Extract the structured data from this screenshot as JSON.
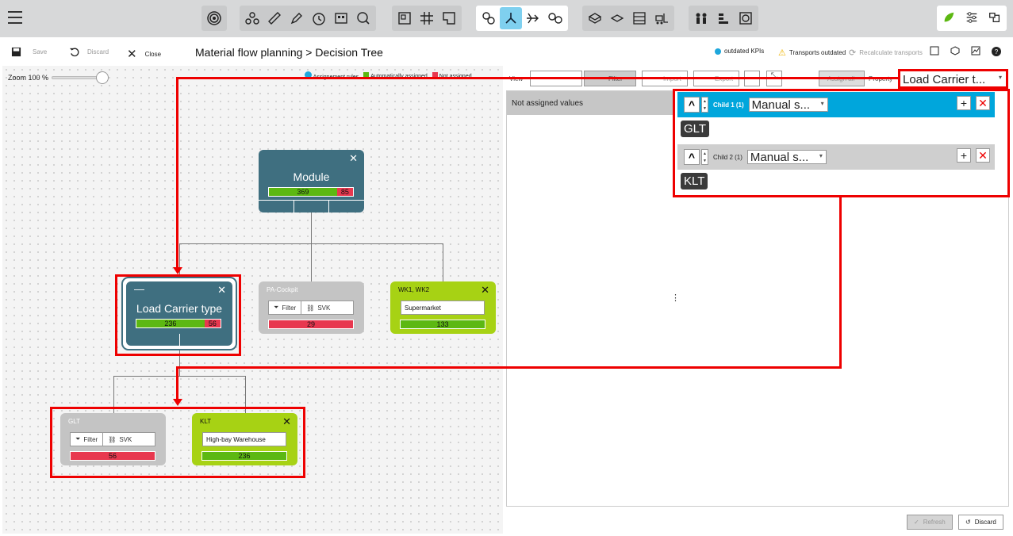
{
  "toolbar": {
    "menu_icon": "hamburger-icon",
    "groups": [
      [
        "target-icon"
      ],
      [
        "network-icon",
        "ruler-icon",
        "pencil-icon",
        "clock-icon",
        "boards-icon",
        "search-zoom-icon"
      ],
      [
        "layout-icon",
        "grid-icon",
        "area-icon"
      ],
      [
        "link-icon",
        "split-icon",
        "flow-icon",
        "chain-icon"
      ],
      [
        "carrier-icon",
        "carrier2-icon",
        "shelf-icon",
        "forklift-icon"
      ],
      [
        "people-icon",
        "stack-icon",
        "frame-icon"
      ]
    ],
    "right": [
      "leaf-icon",
      "sliders-icon",
      "mf-icon"
    ]
  },
  "subbar": {
    "save": "Save",
    "discard": "Discard",
    "close": "Close",
    "breadcrumb": "Material flow planning  >  Decision Tree",
    "kpi_outdated": "outdated KPIs",
    "transports_outdated": "Transports outdated",
    "recalculate": "Recalculate transports"
  },
  "canvas": {
    "zoom_label": "Zoom 100 %",
    "zoom_level": 1.0,
    "legend": [
      "Assignement rules",
      "Automatically assigned",
      "Not assigned"
    ]
  },
  "nodes": {
    "module": {
      "title": "Module",
      "assigned": "369",
      "not_assigned": "85",
      "assigned_fraction": 0.81
    },
    "load_carrier": {
      "title": "Load Carrier type",
      "assigned": "236",
      "not_assigned": "56",
      "assigned_fraction": 0.81
    },
    "pa_cockpit": {
      "header": "PA-Cockpit",
      "filter": "Filter",
      "svk": "SVK",
      "not_assigned": "29"
    },
    "wk": {
      "header": "WK1, WK2",
      "field": "Supermarket",
      "assigned": "133"
    },
    "glt": {
      "header": "GLT",
      "filter": "Filter",
      "svk": "SVK",
      "not_assigned": "56"
    },
    "klt": {
      "header": "KLT",
      "field": "High-bay Warehouse",
      "assigned": "236"
    }
  },
  "right_panel": {
    "view_label": "View",
    "filter_btn": "Filter",
    "import_btn": "Import",
    "export_btn": "Export",
    "assign_btn": "Assign all",
    "property_label": "Property",
    "property_value": "Load Carrier t...",
    "nav_header": "Not assigned values",
    "child1": {
      "label": "Child 1 (1)",
      "select": "Manual s...",
      "chip": "GLT"
    },
    "child2": {
      "label": "Child 2 (1)",
      "select": "Manual s...",
      "chip": "KLT"
    }
  },
  "footer": {
    "refresh": "Refresh",
    "discard": "Discard"
  },
  "colors": {
    "assigned": "#5cb812",
    "not_assigned": "#e8384f",
    "assignment_rules": "#1ea7dc",
    "node_teal": "#3f6f80",
    "node_green": "#a7d214",
    "highlight": "#e00000"
  }
}
